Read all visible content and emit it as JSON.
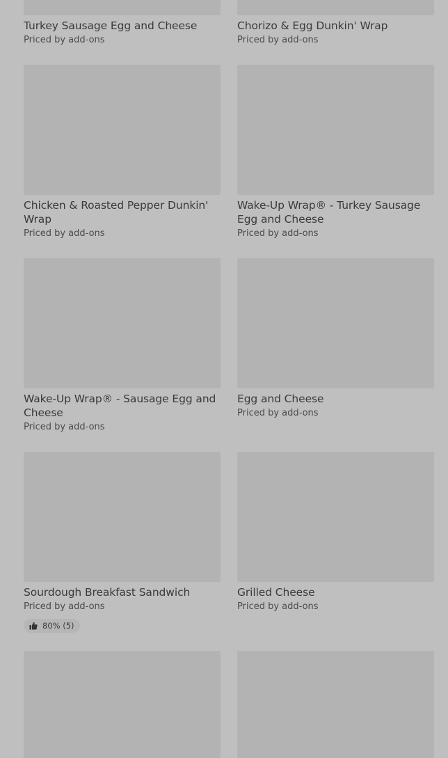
{
  "items": [
    {
      "title": "Turkey Sausage Egg and Cheese",
      "subtitle": "Priced by add-ons"
    },
    {
      "title": "Chorizo & Egg Dunkin' Wrap",
      "subtitle": "Priced by add-ons"
    },
    {
      "title": "Chicken & Roasted Pepper Dunkin' Wrap",
      "subtitle": "Priced by add-ons"
    },
    {
      "title": "Wake-Up Wrap® - Turkey Sausage Egg and Cheese",
      "subtitle": "Priced by add-ons"
    },
    {
      "title": "Wake-Up Wrap® - Sausage Egg and Cheese",
      "subtitle": "Priced by add-ons"
    },
    {
      "title": "Egg and Cheese",
      "subtitle": "Priced by add-ons"
    },
    {
      "title": "Sourdough Breakfast Sandwich",
      "subtitle": "Priced by add-ons",
      "rating": "80% (5)"
    },
    {
      "title": "Grilled Cheese",
      "subtitle": "Priced by add-ons"
    }
  ],
  "icons": {
    "rating": "thumbs-up-icon"
  },
  "colors": {
    "background": "#bfbfbf",
    "image_placeholder": "#b3b3b3",
    "text": "#3a3a3a"
  }
}
